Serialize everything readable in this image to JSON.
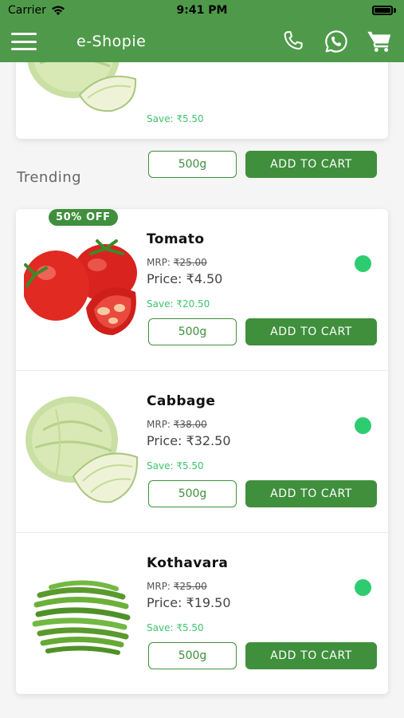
{
  "status_bar": {
    "carrier": "Carrier",
    "time": "9:41 PM"
  },
  "appbar": {
    "title": "e-Shopie",
    "icons": [
      "phone-icon",
      "whatsapp-icon",
      "cart-icon"
    ]
  },
  "top_card": {
    "save": "Save: ₹5.50",
    "weight": "500g",
    "add_label": "ADD TO CART"
  },
  "section": {
    "title": "Trending"
  },
  "products": [
    {
      "name": "Tomato",
      "badge": "50% OFF",
      "mrp_label": "MRP: ",
      "mrp_value": "₹25.00",
      "price": "Price: ₹4.50",
      "save": "Save: ₹20.50",
      "weight": "500g",
      "add_label": "ADD TO CART",
      "image": "tomato"
    },
    {
      "name": "Cabbage",
      "mrp_label": "MRP: ",
      "mrp_value": "₹38.00",
      "price": "Price: ₹32.50",
      "save": "Save: ₹5.50",
      "weight": "500g",
      "add_label": "ADD TO CART",
      "image": "cabbage"
    },
    {
      "name": "Kothavara",
      "mrp_label": "MRP: ",
      "mrp_value": "₹25.00",
      "price": "Price: ₹19.50",
      "save": "Save: ₹5.50",
      "weight": "500g",
      "add_label": "ADD TO CART",
      "image": "beans"
    }
  ],
  "colors": {
    "brand": "#4f9a4a",
    "button": "#3f8f3c",
    "available_dot": "#2ecc71",
    "save_text": "#3ec46d"
  }
}
